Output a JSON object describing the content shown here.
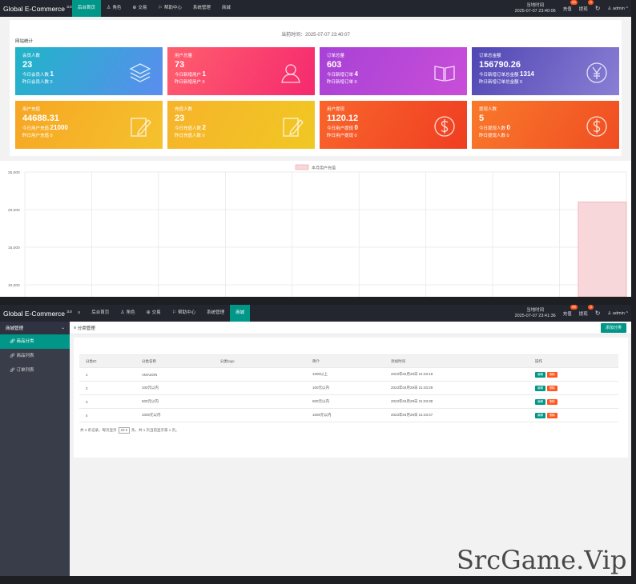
{
  "app": {
    "name": "Global E-Commerce",
    "version": "3.0"
  },
  "screen1": {
    "nav": [
      "后台首页",
      "角色",
      "交易",
      "帮助中心",
      "系统管理",
      "商城"
    ],
    "time_label": "当地时间",
    "time_value": "2025-07-07 23:40:06",
    "recharge": "充值",
    "recharge_badge": "59",
    "withdraw": "提现",
    "withdraw_badge": "3",
    "user": "admin",
    "current_time": "当前时间：2025-07-07 23:40:07",
    "panel_title": "网站统计",
    "cards": [
      {
        "label": "会员人数",
        "value": "23",
        "sub1": "今日会员人数",
        "sub1v": "1",
        "sub2": "昨日会员人数",
        "sub2v": "0",
        "color1": "#1fb5c7",
        "color2": "#5b8def",
        "icon": "layers-icon"
      },
      {
        "label": "用户总量",
        "value": "73",
        "sub1": "今日新增用户",
        "sub1v": "1",
        "sub2": "昨日新增用户",
        "sub2v": "0",
        "color1": "#ff5f6d",
        "color2": "#f5296f",
        "icon": "users-icon"
      },
      {
        "label": "订单总量",
        "value": "603",
        "sub1": "今日新增订单",
        "sub1v": "4",
        "sub2": "昨日新增订单",
        "sub2v": "0",
        "color1": "#a742d6",
        "color2": "#c94ed8",
        "icon": "book-icon"
      },
      {
        "label": "订单总金额",
        "value": "156790.26",
        "sub1": "今日新增订单总金额",
        "sub1v": "1314",
        "sub2": "昨日新增订单总金额",
        "sub2v": "0",
        "color1": "#5046b4",
        "color2": "#8a7fd4",
        "icon": "yen-icon"
      },
      {
        "label": "用户充值",
        "value": "44688.31",
        "sub1": "今日用户充值",
        "sub1v": "21000",
        "sub2": "昨日用户充值",
        "sub2v": "0",
        "color1": "#f6a623",
        "color2": "#f5c22e",
        "icon": "edit-icon"
      },
      {
        "label": "充值人数",
        "value": "23",
        "sub1": "今日充值人数",
        "sub1v": "2",
        "sub2": "昨日充值人数",
        "sub2v": "0",
        "color1": "#f7b32b",
        "color2": "#f0c823",
        "icon": "edit-icon"
      },
      {
        "label": "用户提现",
        "value": "1120.12",
        "sub1": "今日用户提现",
        "sub1v": "0",
        "sub2": "昨日用户提现",
        "sub2v": "0",
        "color1": "#f9652b",
        "color2": "#ef3e22",
        "icon": "dollar-icon"
      },
      {
        "label": "提现人数",
        "value": "5",
        "sub1": "今日提现人数",
        "sub1v": "0",
        "sub2": "昨日提现人数",
        "sub2v": "0",
        "color1": "#f9792b",
        "color2": "#f04d22",
        "icon": "dollar-icon"
      }
    ]
  },
  "chart_data": {
    "type": "bar",
    "legend": "本月用户充值",
    "legend_position": "top-center",
    "y_ticks": [
      "25,000",
      "20,000",
      "15,000",
      "10,000"
    ],
    "ylim": [
      10000,
      25000
    ],
    "categories_count": 9,
    "values": [
      0,
      0,
      0,
      0,
      0,
      0,
      0,
      0,
      21000
    ],
    "grid": true,
    "bar_color": "#f8d7da"
  },
  "screen2": {
    "nav": [
      "后台首页",
      "角色",
      "交易",
      "帮助中心",
      "系统管理",
      "商城"
    ],
    "time_label": "当地时间",
    "time_value": "2025-07-07 23:41:36",
    "recharge": "充值",
    "recharge_badge": "59",
    "withdraw": "提现",
    "withdraw_badge": "3",
    "user": "admin",
    "sidebar_head": "商城管理",
    "sidebar_items": [
      "商品分类",
      "商品列表",
      "订单列表"
    ],
    "crumb": "分类管理",
    "add_button": "添加分类",
    "table_headers": [
      "分类ID",
      "分类名称",
      "分类logo",
      "简介",
      "添加时间",
      "操作"
    ],
    "rows": [
      {
        "id": "1",
        "name": "AMAZON",
        "logo": "",
        "intro": "1000以上",
        "time": "2023年04月29日 21:03:18"
      },
      {
        "id": "2",
        "name": "100元以内",
        "logo": "",
        "intro": "100元以内",
        "time": "2023年04月29日 21:03:29"
      },
      {
        "id": "3",
        "name": "500元以内",
        "logo": "",
        "intro": "500元以内",
        "time": "2023年04月29日 21:03:38"
      },
      {
        "id": "4",
        "name": "1000元以内",
        "logo": "",
        "intro": "1000元以内",
        "time": "2023年04月29日 21:03:47"
      }
    ],
    "edit_label": "编辑",
    "delete_label": "删除",
    "pager_pre": "共 4 条记录，每页显示",
    "pager_size": "20",
    "pager_post": "条，共 1 页当前显示第 1 页。"
  },
  "watermark": "SrcGame.Vip"
}
